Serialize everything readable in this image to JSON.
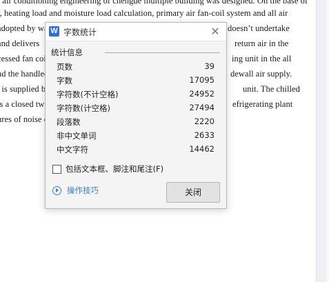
{
  "document": {
    "lines": [
      "f air conditioning engineering of chengde multiple building was designed. On the base of",
      "r, heating load and moisture load calculation, primary air fan-coil system and all air",
      "adopted by wa",
      "and delivers",
      "cessed fan coi",
      "nd the handled",
      ". is supplied b",
      "is a closed tw",
      "ures of noise e"
    ],
    "right_fragments": [
      "doesn’t undertake",
      "return air in the",
      "ing unit in the all",
      "dewall air supply.",
      "unit. The chilled",
      "efrigerating plant"
    ]
  },
  "dialog": {
    "app_icon_letter": "W",
    "title": "字数统计",
    "group_label": "统计信息",
    "stats": [
      {
        "label": "页数",
        "value": "39"
      },
      {
        "label": "字数",
        "value": "17095"
      },
      {
        "label": "字符数(不计空格)",
        "value": "24952"
      },
      {
        "label": "字符数(计空格)",
        "value": "27494"
      },
      {
        "label": "段落数",
        "value": "2220"
      },
      {
        "label": "非中文单词",
        "value": "2633"
      },
      {
        "label": "中文字符",
        "value": "14462"
      }
    ],
    "checkbox_label": "包括文本框、脚注和尾注(F)",
    "checkbox_checked": false,
    "tips_label": "操作技巧",
    "close_button_label": "关闭",
    "close_icon": "✕",
    "accent_color": "#2f6fe0",
    "link_color": "#3a7bd5"
  }
}
